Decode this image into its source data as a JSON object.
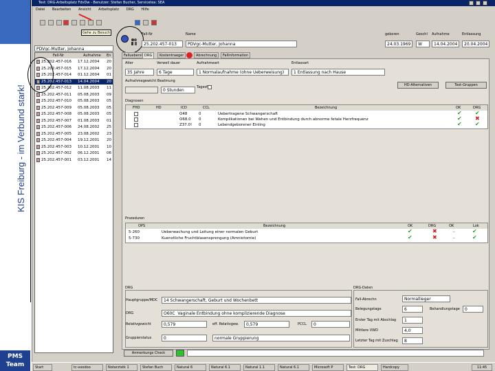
{
  "side_label": "KIS Freiburg - im Verbund stark!",
  "pms_label": [
    "PMS",
    "Team"
  ],
  "window": {
    "title": "Test: DRG-Arbeitsplatz FdvDw - Benutzer: Stefan Bucher, Servicetea: SEA",
    "menu": [
      "Datei",
      "Bearbeiten",
      "Ansicht",
      "Arbeitsplatz",
      "DRG",
      "Hilfe"
    ]
  },
  "tooltip": "Gehe zu Besuch",
  "header": {
    "labels": {
      "fallnr": "Fall-Nr",
      "name": "Name",
      "geboren": "geboren",
      "geschl": "Geschl",
      "aufnahme": "Aufnahme",
      "entlassung": "Entlassung"
    },
    "fallnr": "25.202.457-013",
    "name": "PDVgc-Mutter, Johanna",
    "geboren": "24.03.1969",
    "geschl": "W",
    "aufnahme": "14.04.2004",
    "entlassung": "20.04.2004"
  },
  "patient_list": {
    "search": "PDVgc-Mutter, Johanna",
    "columns": [
      "Fall-Nr",
      "Aufnahme",
      "En"
    ],
    "rows": [
      {
        "id": "25.202.457-016",
        "date": "17.12.2004",
        "end": "20",
        "selected": false
      },
      {
        "id": "25.202.457-015",
        "date": "17.12.2004",
        "end": "20",
        "selected": false
      },
      {
        "id": "25.202.457-014",
        "date": "01.12.2004",
        "end": "01",
        "selected": false
      },
      {
        "id": "25.202.457-013",
        "date": "14.04.2004",
        "end": "20",
        "selected": true
      },
      {
        "id": "25.202.457-012",
        "date": "11.08.2003",
        "end": "11",
        "selected": false
      },
      {
        "id": "25.202.457-011",
        "date": "05.08.2003",
        "end": "09",
        "selected": false
      },
      {
        "id": "25.202.457-010",
        "date": "05.08.2003",
        "end": "05",
        "selected": false
      },
      {
        "id": "25.202.457-009",
        "date": "05.08.2003",
        "end": "05",
        "selected": false
      },
      {
        "id": "25.202.457-008",
        "date": "05.08.2003",
        "end": "05",
        "selected": false
      },
      {
        "id": "25.202.457-007",
        "date": "01.08.2003",
        "end": "01",
        "selected": false
      },
      {
        "id": "25.202.457-006",
        "date": "24.08.2002",
        "end": "25",
        "selected": false
      },
      {
        "id": "25.202.457-005",
        "date": "23.08.2002",
        "end": "23",
        "selected": false
      },
      {
        "id": "25.202.457-004",
        "date": "19.12.2001",
        "end": "20",
        "selected": false
      },
      {
        "id": "25.202.457-003",
        "date": "10.12.2001",
        "end": "10",
        "selected": false
      },
      {
        "id": "25.202.457-002",
        "date": "06.12.2001",
        "end": "06",
        "selected": false
      },
      {
        "id": "25.202.457-001",
        "date": "03.12.2001",
        "end": "14",
        "selected": false
      }
    ]
  },
  "tabs": [
    "Falluebersicht",
    "DRG",
    "Kostentraeger",
    "Abrechnung",
    "Fallinformation"
  ],
  "admin": {
    "labels": {
      "alter": "Alter",
      "verweil": "Verweil dauer",
      "aufnahmeart": "Aufnahmeart",
      "entlassart": "Entlassart",
      "gewicht": "Aufnahmegewicht Beatmung",
      "tagesfall": "Tagesfall"
    },
    "alter": "35 Jahre",
    "verweil": "6 Tage",
    "aufnahmeart": "1  Normalaufnahme (ohne Ueberweisung)",
    "entlassart": "1  Entlassung nach Hause",
    "beatmung": "0  Stunden",
    "buttons": [
      "HD-Alternativen",
      "Test-Gruppen"
    ]
  },
  "diagnoses": {
    "title": "Diagnosen",
    "columns": [
      "FHD",
      "HD",
      "ICD",
      "CCL",
      "Bezeichnung",
      "OK",
      "DRG"
    ],
    "rows": [
      {
        "icd": "O48",
        "ccl": "0",
        "text": "Uebertragene Schwangerschaft",
        "ok": "check",
        "drg": "check"
      },
      {
        "icd": "O68.0",
        "ccl": "0",
        "text": "Komplikationen bei Wehen und Entbindung durch abnorme fetale Herzfrequenz",
        "ok": "check",
        "drg": "cross"
      },
      {
        "icd": "Z37.0!",
        "ccl": "0",
        "text": "Lebendgeborener Einling",
        "ok": "check",
        "drg": "check"
      }
    ]
  },
  "procedures": {
    "title": "Prozeduren",
    "columns": [
      "OPS",
      "Bezeichnung",
      "OK",
      "DRG",
      "OK",
      "Lok"
    ],
    "rows": [
      {
        "ops": "5-260",
        "text": "Ueberwachung und Leitung einer normalen Geburt"
      },
      {
        "ops": "5-730",
        "text": "Kuenstliche Fruchtblasensprengung (Amniotomie)"
      }
    ]
  },
  "drg": {
    "title": "DRG",
    "labels": {
      "hauptgruppe": "Hauptgruppe/MDC",
      "drg": "DRG",
      "relativgewicht": "Relativgewicht",
      "eff": "eff. Relativgew.",
      "pccl": "PCCL",
      "gruppierstatus": "Gruppierstatus"
    },
    "hauptgruppe": "14  Schwangerschaft, Geburt und Wochenbett",
    "drg_code": "O60C",
    "drg_text": "Vaginale Entbindung ohne komplizierende Diagnose",
    "relativgewicht": "0,579",
    "eff": "0,579",
    "pccl": "0",
    "gruppierstatus": "0",
    "status_text": "normale Gruppierung"
  },
  "drg_daten": {
    "title": "DRG-Daten",
    "labels": {
      "abrechn": "Fall-Abrechn",
      "beleg": "Belegungstage",
      "erster": "Erster Tag mit Abschlag",
      "mittlere": "Mittlere VWD",
      "letzter": "Letzter Tag mit Zuschlag",
      "beh": "Behandlungstage"
    },
    "abrechn": "Normallieger",
    "beleg": "6",
    "beh": "0",
    "erster": "1",
    "mittlere": "4,0",
    "letzter": "8"
  },
  "status_button": "Anmerkungs Check",
  "taskbar": [
    "Start",
    "tc-voodoo",
    "Notarztstk 1",
    "Stefan Buch",
    "Natural 6",
    "Natural 6.1",
    "Natural 1.1",
    "Natural 6.1",
    "Microsoft P",
    "Test: DRG",
    "Hardcopy"
  ],
  "clock": "11:45"
}
